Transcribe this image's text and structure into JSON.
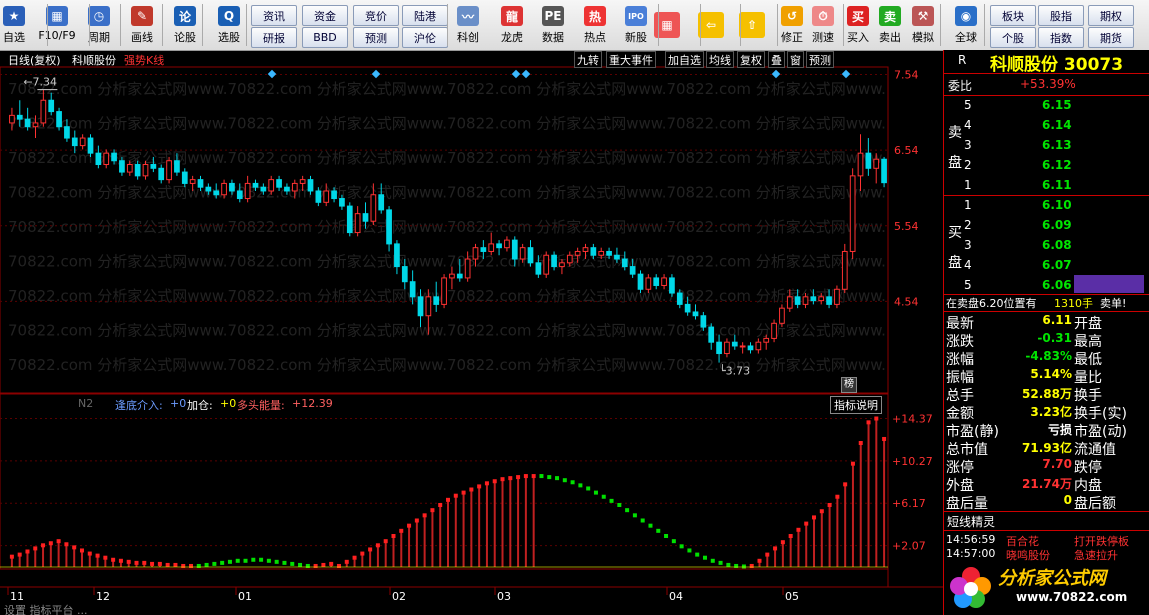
{
  "toolbar": {
    "items": [
      {
        "label": "自选",
        "icon": "star-icon",
        "color": "#2a5fb8",
        "glyph": "★"
      },
      {
        "label": "F10/F9",
        "icon": "grid-icon",
        "color": "#3a6fc8",
        "glyph": "▦"
      },
      {
        "label": "周期",
        "icon": "clock-icon",
        "color": "#3a6fc8",
        "glyph": "◷"
      },
      {
        "label": "画线",
        "icon": "pen-icon",
        "color": "#c0392b",
        "glyph": "✎"
      },
      {
        "label": "论股",
        "icon": "chat-icon",
        "color": "#1a5fb4",
        "glyph": "论"
      },
      {
        "label": "选股",
        "icon": "search-chart-icon",
        "color": "#1a5fb4",
        "glyph": "Q"
      },
      {
        "label": "科创",
        "icon": "sci-board-icon",
        "color": "#6a8fc8",
        "glyph": "〰"
      },
      {
        "label": "龙虎",
        "icon": "dragon-tiger-icon",
        "color": "#d33",
        "glyph": "龍"
      },
      {
        "label": "数据",
        "icon": "pe-icon",
        "color": "#555",
        "glyph": "PE"
      },
      {
        "label": "热点",
        "icon": "hot-icon",
        "color": "#e33",
        "glyph": "热"
      },
      {
        "label": "新股",
        "icon": "ipo-icon",
        "color": "#4a7fd8",
        "glyph": "IPO"
      },
      {
        "label": "修正",
        "icon": "correct-icon",
        "color": "#f0a000",
        "glyph": "↺"
      },
      {
        "label": "测速",
        "icon": "speed-icon",
        "color": "#e88",
        "glyph": "⏱"
      },
      {
        "label": "买入",
        "icon": "buy-icon",
        "color": "#d22",
        "glyph": "买"
      },
      {
        "label": "卖出",
        "icon": "sell-icon",
        "color": "#2a2",
        "glyph": "卖"
      },
      {
        "label": "模拟",
        "icon": "hammer-icon",
        "color": "#b55",
        "glyph": "⚒"
      },
      {
        "label": "全球",
        "icon": "globe-icon",
        "color": "#2a6fc8",
        "glyph": "◉"
      }
    ],
    "small_buttons": [
      "资讯",
      "资金",
      "竞价",
      "陆港",
      "研报",
      "BBD",
      "预测",
      "沪伦"
    ],
    "right_buttons": [
      "板块",
      "股指",
      "期权",
      "个股",
      "指数",
      "期货"
    ]
  },
  "chart": {
    "title_bar": {
      "period": "日线(复权)",
      "stock": "科顺股份",
      "indicator": "强势K线"
    },
    "buttons": [
      "九转",
      "重大事件",
      "加自选",
      "均线",
      "复权",
      "叠",
      "窗",
      "预测"
    ],
    "price_axis": [
      "7.54",
      "6.54",
      "5.54",
      "4.54"
    ],
    "high_label": "7.34",
    "low_label": "3.73",
    "rank_badge": "榜",
    "watermark": "70822.com 分析家公式网www.70822.com 分析家公式网www.70822.com 分析家公式网www.70822.com 分析家公式网www.",
    "indicator_bar": {
      "name": "N2",
      "item1_label": "逢底介入:",
      "item1_value": "+0",
      "item2_label": "加仓:",
      "item2_value": "+0",
      "item3_label": "多头能量:",
      "item3_value": "+12.39"
    },
    "indicator_help": "指标说明",
    "indicator_axis": [
      "+14.37",
      "+10.27",
      "+6.17",
      "+2.07"
    ],
    "date_labels": [
      "11",
      "12",
      "01",
      "02",
      "03",
      "04",
      "05"
    ],
    "bottom_tabs_text": "设置  指标平台  ..."
  },
  "chart_data": {
    "type": "candlestick",
    "price_range": [
      3.5,
      7.6
    ],
    "energy_range": [
      0,
      15
    ],
    "candles": [
      {
        "o": 6.9,
        "h": 7.1,
        "l": 6.8,
        "c": 7.0
      },
      {
        "o": 7.0,
        "h": 7.2,
        "l": 6.85,
        "c": 6.95
      },
      {
        "o": 6.95,
        "h": 7.1,
        "l": 6.8,
        "c": 6.85
      },
      {
        "o": 6.85,
        "h": 7.0,
        "l": 6.7,
        "c": 6.9
      },
      {
        "o": 6.9,
        "h": 7.34,
        "l": 6.85,
        "c": 7.2
      },
      {
        "o": 7.2,
        "h": 7.3,
        "l": 7.0,
        "c": 7.05
      },
      {
        "o": 7.05,
        "h": 7.1,
        "l": 6.8,
        "c": 6.85
      },
      {
        "o": 6.85,
        "h": 6.95,
        "l": 6.65,
        "c": 6.7
      },
      {
        "o": 6.7,
        "h": 6.8,
        "l": 6.5,
        "c": 6.6
      },
      {
        "o": 6.6,
        "h": 6.75,
        "l": 6.55,
        "c": 6.7
      },
      {
        "o": 6.7,
        "h": 6.75,
        "l": 6.45,
        "c": 6.5
      },
      {
        "o": 6.5,
        "h": 6.6,
        "l": 6.3,
        "c": 6.35
      },
      {
        "o": 6.35,
        "h": 6.55,
        "l": 6.3,
        "c": 6.5
      },
      {
        "o": 6.5,
        "h": 6.55,
        "l": 6.35,
        "c": 6.4
      },
      {
        "o": 6.4,
        "h": 6.45,
        "l": 6.2,
        "c": 6.25
      },
      {
        "o": 6.25,
        "h": 6.4,
        "l": 6.2,
        "c": 6.35
      },
      {
        "o": 6.35,
        "h": 6.4,
        "l": 6.15,
        "c": 6.2
      },
      {
        "o": 6.2,
        "h": 6.4,
        "l": 6.15,
        "c": 6.35
      },
      {
        "o": 6.35,
        "h": 6.45,
        "l": 6.25,
        "c": 6.3
      },
      {
        "o": 6.3,
        "h": 6.35,
        "l": 6.1,
        "c": 6.15
      },
      {
        "o": 6.15,
        "h": 6.45,
        "l": 6.1,
        "c": 6.4
      },
      {
        "o": 6.4,
        "h": 6.5,
        "l": 6.2,
        "c": 6.25
      },
      {
        "o": 6.25,
        "h": 6.3,
        "l": 6.05,
        "c": 6.1
      },
      {
        "o": 6.1,
        "h": 6.2,
        "l": 6.0,
        "c": 6.15
      },
      {
        "o": 6.15,
        "h": 6.2,
        "l": 6.0,
        "c": 6.05
      },
      {
        "o": 6.05,
        "h": 6.1,
        "l": 5.95,
        "c": 6.0
      },
      {
        "o": 6.0,
        "h": 6.1,
        "l": 5.9,
        "c": 5.95
      },
      {
        "o": 5.95,
        "h": 6.15,
        "l": 5.9,
        "c": 6.1
      },
      {
        "o": 6.1,
        "h": 6.15,
        "l": 5.95,
        "c": 6.0
      },
      {
        "o": 6.0,
        "h": 6.1,
        "l": 5.85,
        "c": 5.9
      },
      {
        "o": 5.9,
        "h": 6.2,
        "l": 5.85,
        "c": 6.1
      },
      {
        "o": 6.1,
        "h": 6.15,
        "l": 6.0,
        "c": 6.05
      },
      {
        "o": 6.05,
        "h": 6.1,
        "l": 5.95,
        "c": 6.0
      },
      {
        "o": 6.0,
        "h": 6.2,
        "l": 5.95,
        "c": 6.15
      },
      {
        "o": 6.15,
        "h": 6.2,
        "l": 6.0,
        "c": 6.05
      },
      {
        "o": 6.05,
        "h": 6.1,
        "l": 5.95,
        "c": 6.0
      },
      {
        "o": 6.0,
        "h": 6.15,
        "l": 5.9,
        "c": 6.1
      },
      {
        "o": 6.1,
        "h": 6.2,
        "l": 6.0,
        "c": 6.15
      },
      {
        "o": 6.15,
        "h": 6.2,
        "l": 5.95,
        "c": 6.0
      },
      {
        "o": 6.0,
        "h": 6.05,
        "l": 5.8,
        "c": 5.85
      },
      {
        "o": 5.85,
        "h": 6.1,
        "l": 5.8,
        "c": 6.0
      },
      {
        "o": 6.0,
        "h": 6.05,
        "l": 5.85,
        "c": 5.9
      },
      {
        "o": 5.9,
        "h": 5.95,
        "l": 5.75,
        "c": 5.8
      },
      {
        "o": 5.8,
        "h": 5.85,
        "l": 5.4,
        "c": 5.45
      },
      {
        "o": 5.45,
        "h": 5.8,
        "l": 5.4,
        "c": 5.7
      },
      {
        "o": 5.7,
        "h": 5.85,
        "l": 5.5,
        "c": 5.6
      },
      {
        "o": 5.6,
        "h": 6.1,
        "l": 5.55,
        "c": 5.95
      },
      {
        "o": 5.95,
        "h": 6.1,
        "l": 5.7,
        "c": 5.75
      },
      {
        "o": 5.75,
        "h": 5.8,
        "l": 5.2,
        "c": 5.3
      },
      {
        "o": 5.3,
        "h": 5.35,
        "l": 4.9,
        "c": 5.0
      },
      {
        "o": 5.0,
        "h": 5.1,
        "l": 4.7,
        "c": 4.8
      },
      {
        "o": 4.8,
        "h": 4.95,
        "l": 4.5,
        "c": 4.6
      },
      {
        "o": 4.6,
        "h": 4.7,
        "l": 4.2,
        "c": 4.35
      },
      {
        "o": 4.35,
        "h": 4.7,
        "l": 4.1,
        "c": 4.6
      },
      {
        "o": 4.6,
        "h": 4.8,
        "l": 4.4,
        "c": 4.5
      },
      {
        "o": 4.5,
        "h": 4.9,
        "l": 4.45,
        "c": 4.85
      },
      {
        "o": 4.85,
        "h": 5.0,
        "l": 4.7,
        "c": 4.9
      },
      {
        "o": 4.9,
        "h": 5.1,
        "l": 4.8,
        "c": 4.85
      },
      {
        "o": 4.85,
        "h": 5.2,
        "l": 4.8,
        "c": 5.1
      },
      {
        "o": 5.1,
        "h": 5.3,
        "l": 5.0,
        "c": 5.25
      },
      {
        "o": 5.25,
        "h": 5.35,
        "l": 5.1,
        "c": 5.2
      },
      {
        "o": 5.2,
        "h": 5.45,
        "l": 5.15,
        "c": 5.3
      },
      {
        "o": 5.3,
        "h": 5.35,
        "l": 5.15,
        "c": 5.25
      },
      {
        "o": 5.25,
        "h": 5.4,
        "l": 5.2,
        "c": 5.35
      },
      {
        "o": 5.35,
        "h": 5.4,
        "l": 5.0,
        "c": 5.1
      },
      {
        "o": 5.1,
        "h": 5.3,
        "l": 5.05,
        "c": 5.25
      },
      {
        "o": 5.25,
        "h": 5.35,
        "l": 5.0,
        "c": 5.05
      },
      {
        "o": 5.05,
        "h": 5.15,
        "l": 4.85,
        "c": 4.9
      },
      {
        "o": 4.9,
        "h": 5.2,
        "l": 4.85,
        "c": 5.15
      },
      {
        "o": 5.15,
        "h": 5.2,
        "l": 4.95,
        "c": 5.0
      },
      {
        "o": 5.0,
        "h": 5.1,
        "l": 4.9,
        "c": 5.05
      },
      {
        "o": 5.05,
        "h": 5.2,
        "l": 5.0,
        "c": 5.15
      },
      {
        "o": 5.15,
        "h": 5.25,
        "l": 5.05,
        "c": 5.2
      },
      {
        "o": 5.2,
        "h": 5.3,
        "l": 5.1,
        "c": 5.25
      },
      {
        "o": 5.25,
        "h": 5.3,
        "l": 5.1,
        "c": 5.15
      },
      {
        "o": 5.15,
        "h": 5.25,
        "l": 5.1,
        "c": 5.2
      },
      {
        "o": 5.2,
        "h": 5.25,
        "l": 5.1,
        "c": 5.15
      },
      {
        "o": 5.15,
        "h": 5.25,
        "l": 5.05,
        "c": 5.1
      },
      {
        "o": 5.1,
        "h": 5.2,
        "l": 4.95,
        "c": 5.0
      },
      {
        "o": 5.0,
        "h": 5.1,
        "l": 4.85,
        "c": 4.9
      },
      {
        "o": 4.9,
        "h": 4.95,
        "l": 4.65,
        "c": 4.7
      },
      {
        "o": 4.7,
        "h": 4.9,
        "l": 4.65,
        "c": 4.85
      },
      {
        "o": 4.85,
        "h": 4.9,
        "l": 4.7,
        "c": 4.75
      },
      {
        "o": 4.75,
        "h": 4.9,
        "l": 4.7,
        "c": 4.85
      },
      {
        "o": 4.85,
        "h": 4.9,
        "l": 4.6,
        "c": 4.65
      },
      {
        "o": 4.65,
        "h": 4.7,
        "l": 4.45,
        "c": 4.5
      },
      {
        "o": 4.5,
        "h": 4.6,
        "l": 4.35,
        "c": 4.4
      },
      {
        "o": 4.4,
        "h": 4.5,
        "l": 4.3,
        "c": 4.35
      },
      {
        "o": 4.35,
        "h": 4.4,
        "l": 4.15,
        "c": 4.2
      },
      {
        "o": 4.2,
        "h": 4.25,
        "l": 3.9,
        "c": 4.0
      },
      {
        "o": 4.0,
        "h": 4.1,
        "l": 3.73,
        "c": 3.85
      },
      {
        "o": 3.85,
        "h": 4.05,
        "l": 3.8,
        "c": 4.0
      },
      {
        "o": 4.0,
        "h": 4.1,
        "l": 3.9,
        "c": 3.95
      },
      {
        "o": 3.95,
        "h": 4.0,
        "l": 3.85,
        "c": 3.95
      },
      {
        "o": 3.95,
        "h": 4.0,
        "l": 3.85,
        "c": 3.9
      },
      {
        "o": 3.9,
        "h": 4.05,
        "l": 3.85,
        "c": 4.0
      },
      {
        "o": 4.0,
        "h": 4.1,
        "l": 3.9,
        "c": 4.05
      },
      {
        "o": 4.05,
        "h": 4.3,
        "l": 4.0,
        "c": 4.25
      },
      {
        "o": 4.25,
        "h": 4.5,
        "l": 4.2,
        "c": 4.45
      },
      {
        "o": 4.45,
        "h": 4.7,
        "l": 4.4,
        "c": 4.6
      },
      {
        "o": 4.6,
        "h": 4.7,
        "l": 4.45,
        "c": 4.5
      },
      {
        "o": 4.5,
        "h": 4.65,
        "l": 4.45,
        "c": 4.6
      },
      {
        "o": 4.6,
        "h": 4.7,
        "l": 4.5,
        "c": 4.55
      },
      {
        "o": 4.55,
        "h": 4.65,
        "l": 4.5,
        "c": 4.6
      },
      {
        "o": 4.6,
        "h": 4.7,
        "l": 4.45,
        "c": 4.5
      },
      {
        "o": 4.5,
        "h": 4.75,
        "l": 4.45,
        "c": 4.7
      },
      {
        "o": 4.7,
        "h": 5.3,
        "l": 4.65,
        "c": 5.2
      },
      {
        "o": 5.2,
        "h": 6.3,
        "l": 5.1,
        "c": 6.2
      },
      {
        "o": 6.2,
        "h": 6.75,
        "l": 6.0,
        "c": 6.5
      },
      {
        "o": 6.5,
        "h": 6.7,
        "l": 6.2,
        "c": 6.3
      },
      {
        "o": 6.3,
        "h": 6.5,
        "l": 6.1,
        "c": 6.42
      },
      {
        "o": 6.42,
        "h": 6.45,
        "l": 6.05,
        "c": 6.11
      }
    ],
    "energy": [
      1,
      1.2,
      1.5,
      1.8,
      2.1,
      2.3,
      2.5,
      2.2,
      1.9,
      1.6,
      1.3,
      1.1,
      0.9,
      0.7,
      0.6,
      0.5,
      0.4,
      0.4,
      0.3,
      0.3,
      0.2,
      0.2,
      0.1,
      0.1,
      -0.1,
      -0.2,
      -0.3,
      -0.4,
      -0.5,
      -0.6,
      -0.6,
      -0.7,
      -0.7,
      -0.6,
      -0.5,
      -0.4,
      -0.3,
      -0.2,
      -0.1,
      0.1,
      0.2,
      0.3,
      0.1,
      0.5,
      0.9,
      1.3,
      1.7,
      2.1,
      2.5,
      3.0,
      3.5,
      4.0,
      4.5,
      5.0,
      5.5,
      6.0,
      6.5,
      6.9,
      7.2,
      7.5,
      7.8,
      8.1,
      8.3,
      8.5,
      8.6,
      8.7,
      8.8,
      8.8,
      8.8,
      8.7,
      8.6,
      8.4,
      8.2,
      7.9,
      7.6,
      7.2,
      6.8,
      6.4,
      6.0,
      5.5,
      5.0,
      4.5,
      4.0,
      3.5,
      3.0,
      2.5,
      2.0,
      1.6,
      1.2,
      0.9,
      0.6,
      0.4,
      0.2,
      0.1,
      0.05,
      0.1,
      0.6,
      1.2,
      1.8,
      2.4,
      3.0,
      3.6,
      4.2,
      4.8,
      5.4,
      6.0,
      6.8,
      8.0,
      10.0,
      12.0,
      14.0,
      14.37,
      12.39
    ],
    "energy_color": [
      "r",
      "r",
      "r",
      "r",
      "r",
      "r",
      "r",
      "r",
      "r",
      "r",
      "r",
      "r",
      "r",
      "r",
      "r",
      "r",
      "r",
      "r",
      "r",
      "r",
      "r",
      "r",
      "r",
      "r",
      "g",
      "g",
      "g",
      "g",
      "g",
      "g",
      "g",
      "g",
      "g",
      "g",
      "g",
      "g",
      "g",
      "g",
      "g",
      "r",
      "r",
      "r",
      "r",
      "r",
      "r",
      "r",
      "r",
      "r",
      "r",
      "r",
      "r",
      "r",
      "r",
      "r",
      "r",
      "r",
      "r",
      "r",
      "r",
      "r",
      "r",
      "r",
      "r",
      "r",
      "r",
      "r",
      "r",
      "r",
      "g",
      "g",
      "g",
      "g",
      "g",
      "g",
      "g",
      "g",
      "g",
      "g",
      "g",
      "g",
      "g",
      "g",
      "g",
      "g",
      "g",
      "g",
      "g",
      "g",
      "g",
      "g",
      "g",
      "g",
      "g",
      "g",
      "g",
      "r",
      "r",
      "r",
      "r",
      "r",
      "r",
      "r",
      "r",
      "r",
      "r",
      "r",
      "r",
      "r",
      "r",
      "r",
      "r",
      "r",
      "r"
    ]
  },
  "panel": {
    "r_label": "R",
    "stock_header": "科顺股份 30073",
    "weibi_label": "委比",
    "weibi_value": "+53.39%",
    "sell_label": "卖盘",
    "buy_label": "买盘",
    "sell": [
      {
        "n": "5",
        "p": "6.15"
      },
      {
        "n": "4",
        "p": "6.14"
      },
      {
        "n": "3",
        "p": "6.13"
      },
      {
        "n": "2",
        "p": "6.12"
      },
      {
        "n": "1",
        "p": "6.11"
      }
    ],
    "buy": [
      {
        "n": "1",
        "p": "6.10"
      },
      {
        "n": "2",
        "p": "6.09"
      },
      {
        "n": "3",
        "p": "6.08"
      },
      {
        "n": "4",
        "p": "6.07"
      },
      {
        "n": "5",
        "p": "6.06"
      }
    ],
    "alert_text": "在卖盘6.20位置有",
    "alert_qty": "1310手",
    "alert_tag": "卖单!",
    "quotes": [
      {
        "l": "最新",
        "v": "6.11",
        "vc": "yel",
        "r": "开盘"
      },
      {
        "l": "涨跌",
        "v": "-0.31",
        "vc": "grn",
        "r": "最高"
      },
      {
        "l": "涨幅",
        "v": "-4.83%",
        "vc": "grn",
        "r": "最低"
      },
      {
        "l": "振幅",
        "v": "5.14%",
        "vc": "yel",
        "r": "量比"
      },
      {
        "l": "总手",
        "v": "52.88万",
        "vc": "yel",
        "r": "换手"
      },
      {
        "l": "金额",
        "v": "3.23亿",
        "vc": "yel",
        "r": "换手(实)"
      },
      {
        "l": "市盈(静)",
        "v": "亏损",
        "vc": "lbl",
        "r": "市盈(动)"
      },
      {
        "l": "总市值",
        "v": "71.93亿",
        "vc": "yel",
        "r": "流通值"
      },
      {
        "l": "涨停",
        "v": "7.70",
        "vc": "red",
        "r": "跌停"
      },
      {
        "l": "外盘",
        "v": "21.74万",
        "vc": "red",
        "r": "内盘"
      },
      {
        "l": "盘后量",
        "v": "0",
        "vc": "yel",
        "r": "盘后额"
      }
    ],
    "sprite_title": "短线精灵",
    "sprite_rows": [
      {
        "t": "14:56:59",
        "n": "百合花",
        "e": "打开跌停板"
      },
      {
        "t": "14:57:00",
        "n": "晓鸣股份",
        "e": "急速拉升"
      }
    ],
    "logo_text": "分析家公式网",
    "logo_url": "www.70822.com"
  }
}
